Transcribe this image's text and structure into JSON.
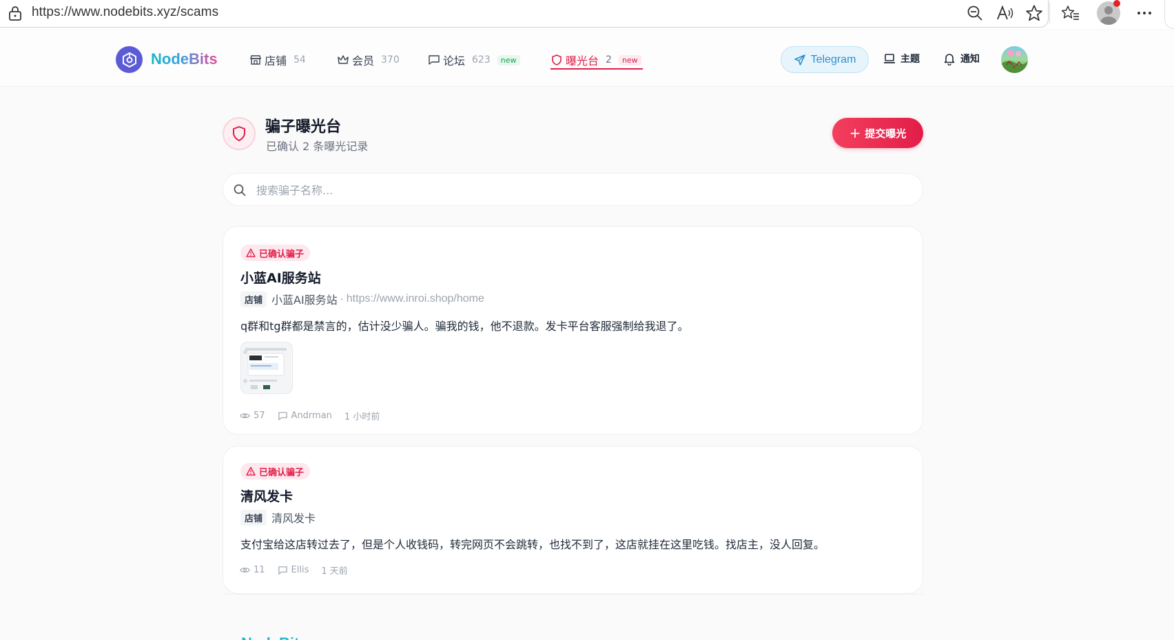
{
  "browser": {
    "url": "https://www.nodebits.xyz/scams"
  },
  "header": {
    "logo_text": "NodeBits",
    "nav": [
      {
        "label": "店铺",
        "count": "54",
        "icon": "store-icon"
      },
      {
        "label": "会员",
        "count": "370",
        "icon": "crown-icon"
      },
      {
        "label": "论坛",
        "count": "623",
        "badge": "new",
        "icon": "chat-icon"
      },
      {
        "label": "曝光台",
        "count": "2",
        "badge": "new",
        "icon": "shield-icon",
        "active": true
      }
    ],
    "telegram_label": "Telegram",
    "topics_label": "主题",
    "notify_label": "通知"
  },
  "page": {
    "title": "骗子曝光台",
    "subtitle": "已确认 2 条曝光记录",
    "submit_label": "提交曝光"
  },
  "search": {
    "placeholder": "搜索骗子名称..."
  },
  "posts": [
    {
      "status": "已确认骗子",
      "title": "小蓝AI服务站",
      "tag": "店铺",
      "shop_name": "小蓝AI服务站",
      "separator": "·",
      "url": "https://www.inroi.shop/home",
      "body": "q群和tg群都是禁言的，估计没少骗人。骗我的钱，他不退款。发卡平台客服强制给我退了。",
      "views": "57",
      "author": "Andrman",
      "time": "1 小时前",
      "has_thumbnail": true
    },
    {
      "status": "已确认骗子",
      "title": "清风发卡",
      "tag": "店铺",
      "shop_name": "清风发卡",
      "body": "支付宝给这店转过去了，但是个人收钱码，转完网页不会跳转，也找不到了，这店就挂在这里吃钱。找店主，没人回复。",
      "views": "11",
      "author": "Ellis",
      "time": "1 天前",
      "has_thumbnail": false
    }
  ],
  "footer": {
    "logo_text": "NodeBits"
  },
  "colors": {
    "accent": "#e11d48",
    "brand": "#5b5bd6",
    "telegram": "#2a8fd1"
  }
}
